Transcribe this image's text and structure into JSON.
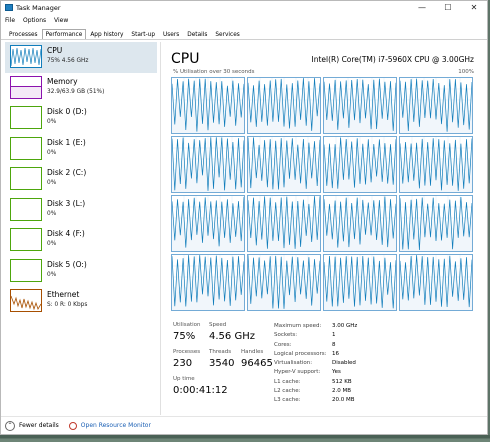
{
  "window": {
    "title": "Task Manager",
    "controls": [
      "—",
      "☐",
      "✕"
    ]
  },
  "menu": [
    "File",
    "Options",
    "View"
  ],
  "tabs": [
    "Processes",
    "Performance",
    "App history",
    "Start-up",
    "Users",
    "Details",
    "Services"
  ],
  "active_tab": "Performance",
  "sidebar": [
    {
      "name": "CPU",
      "value": "75% 4.56 GHz",
      "color": "#117dbb",
      "selected": true
    },
    {
      "name": "Memory",
      "value": "32.9/63.9 GB (51%)",
      "color": "#8b12ae",
      "selected": false
    },
    {
      "name": "Disk 0 (D:)",
      "value": "0%",
      "color": "#4da60c",
      "selected": false
    },
    {
      "name": "Disk 1 (E:)",
      "value": "0%",
      "color": "#4da60c",
      "selected": false
    },
    {
      "name": "Disk 2 (C:)",
      "value": "0%",
      "color": "#4da60c",
      "selected": false
    },
    {
      "name": "Disk 3 (L:)",
      "value": "0%",
      "color": "#4da60c",
      "selected": false
    },
    {
      "name": "Disk 4 (F:)",
      "value": "0%",
      "color": "#4da60c",
      "selected": false
    },
    {
      "name": "Disk 5 (O:)",
      "value": "0%",
      "color": "#4da60c",
      "selected": false
    },
    {
      "name": "Ethernet",
      "value": "S: 0 R: 0 Kbps",
      "color": "#a74f01",
      "selected": false
    }
  ],
  "main": {
    "title": "CPU",
    "model": "Intel(R) Core(TM) i7-5960X CPU @ 3.00GHz",
    "graph_label": "% Utilisation over 30 seconds",
    "graph_max": "100%",
    "graph_color": "#117dbb",
    "logical_graph_count": 16
  },
  "stats": {
    "utilisation": {
      "label": "Utilisation",
      "value": "75%"
    },
    "speed": {
      "label": "Speed",
      "value": "4.56 GHz"
    },
    "processes": {
      "label": "Processes",
      "value": "230"
    },
    "threads": {
      "label": "Threads",
      "value": "3540"
    },
    "handles": {
      "label": "Handles",
      "value": "96465"
    },
    "uptime": {
      "label": "Up time",
      "value": "0:00:41:12"
    }
  },
  "specs": [
    {
      "k": "Maximum speed:",
      "v": "3.00 GHz"
    },
    {
      "k": "Sockets:",
      "v": "1"
    },
    {
      "k": "Cores:",
      "v": "8"
    },
    {
      "k": "Logical processors:",
      "v": "16"
    },
    {
      "k": "Virtualisation:",
      "v": "Disabled"
    },
    {
      "k": "Hyper-V support:",
      "v": "Yes"
    },
    {
      "k": "L1 cache:",
      "v": "512 KB"
    },
    {
      "k": "L2 cache:",
      "v": "2.0 MB"
    },
    {
      "k": "L3 cache:",
      "v": "20.0 MB"
    }
  ],
  "footer": {
    "fewer_details": "Fewer details",
    "open_monitor": "Open Resource Monitor"
  }
}
